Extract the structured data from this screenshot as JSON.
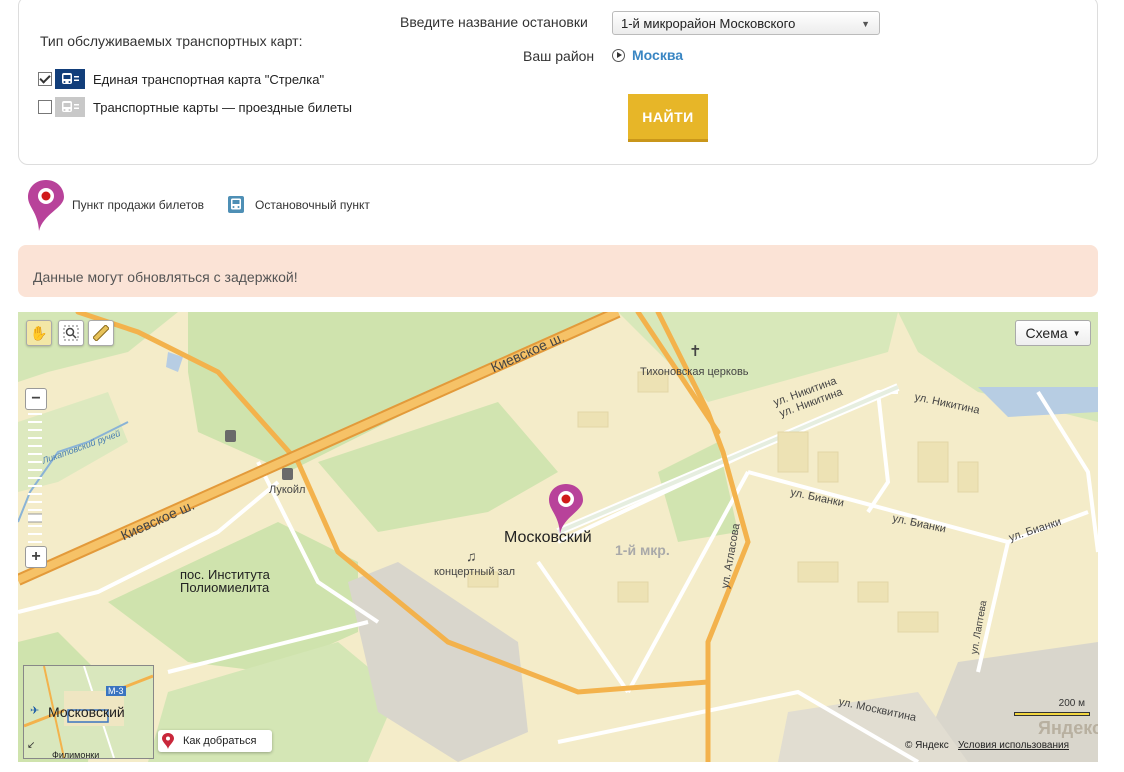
{
  "form": {
    "card_type_title": "Тип обслуживаемых транспортных карт:",
    "cards": [
      {
        "label": "Единая транспортная карта \"Стрелка\"",
        "checked": true,
        "icon": "bus-card-icon",
        "icon_color": "#123e7a"
      },
      {
        "label": "Транспортные карты — проездные билеты",
        "checked": false,
        "icon": "bus-card-icon",
        "icon_color": "#c8c8c8"
      }
    ],
    "stop_label": "Введите название остановки",
    "stop_value": "1-й микрорайон Московского",
    "district_label": "Ваш район",
    "district_value": "Москва",
    "find_button": "НАЙТИ"
  },
  "legend": {
    "sale_point": "Пункт продажи билетов",
    "stop_point": "Остановочный пункт"
  },
  "notice": "Данные могут обновляться с задержкой!",
  "map": {
    "scheme_button": "Схема",
    "roads": {
      "kievskoe_top": "Киевское ш.",
      "kievskoe_bottom": "Киевское ш.",
      "nikitina_1": "ул. Никитина",
      "nikitina_2": "ул. Никитина",
      "nikitina_3": "ул. Никитина",
      "bianki_1": "ул. Бианки",
      "bianki_2": "ул. Бианки",
      "bianki_3": "ул. Бианки",
      "atlasova": "ул. Атласова",
      "lapteva": "ул. Лаптева",
      "moskvitina": "ул. Москвитина",
      "stream": "Ликатовский ручей"
    },
    "places": {
      "church": "Тихоновская церковь",
      "lukoil": "Лукойл",
      "moskovsky": "Московский",
      "microdistrict": "1-й мкр.",
      "concert_hall": "концертный зал",
      "settlement": "пос. Института\nПолиомиелита"
    },
    "minimap": {
      "label": "Московский",
      "highway": "М-3",
      "bottom_label": "Филимонки"
    },
    "route_button": "Как добраться",
    "scale_text": "200 м",
    "logo": "Яндекс",
    "copyright": "© Яндекс",
    "terms": "Условия использования"
  },
  "colors": {
    "accent_button": "#e7b628",
    "district_link": "#3a86c3",
    "pin": "#b8429a",
    "notice_bg": "#fbe3d6"
  }
}
